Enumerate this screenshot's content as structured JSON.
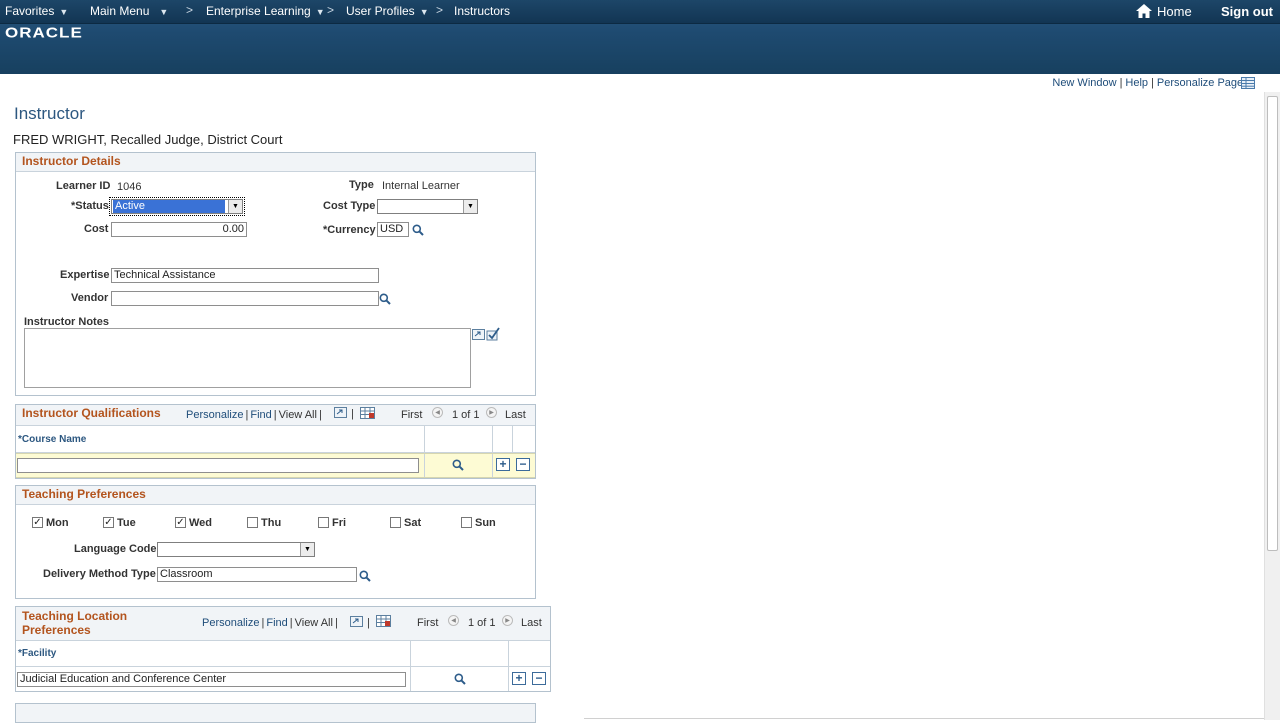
{
  "nav": {
    "favorites": "Favorites",
    "main_menu": "Main Menu",
    "breadcrumb": [
      "Enterprise Learning",
      "User Profiles",
      "Instructors"
    ],
    "separator": ">",
    "home": "Home",
    "sign_out": "Sign out"
  },
  "brand": {
    "logo": "ORACLE"
  },
  "page_links": {
    "new_window": "New Window",
    "help": "Help",
    "personalize_page": "Personalize Page"
  },
  "page": {
    "title": "Instructor",
    "subtitle": "FRED WRIGHT, Recalled Judge, District Court"
  },
  "details": {
    "title": "Instructor Details",
    "learner_id_label": "Learner ID",
    "learner_id": "1046",
    "type_label": "Type",
    "type": "Internal Learner",
    "status_label": "*Status",
    "status": "Active",
    "cost_type_label": "Cost Type",
    "cost_type": "",
    "cost_label": "Cost",
    "cost": "0.00",
    "currency_label": "*Currency",
    "currency": "USD",
    "expertise_label": "Expertise",
    "expertise": "Technical Assistance",
    "vendor_label": "Vendor",
    "vendor": "",
    "notes_label": "Instructor Notes"
  },
  "qualifications": {
    "title": "Instructor Qualifications",
    "personalize": "Personalize",
    "find": "Find",
    "view_all": "View All",
    "first": "First",
    "range": "1 of 1",
    "last": "Last",
    "col_course": "*Course Name",
    "course": ""
  },
  "teaching": {
    "title": "Teaching Preferences",
    "days": [
      {
        "label": "Mon",
        "checked": true
      },
      {
        "label": "Tue",
        "checked": true
      },
      {
        "label": "Wed",
        "checked": true
      },
      {
        "label": "Thu",
        "checked": false
      },
      {
        "label": "Fri",
        "checked": false
      },
      {
        "label": "Sat",
        "checked": false
      },
      {
        "label": "Sun",
        "checked": false
      }
    ],
    "language_label": "Language Code",
    "language": "",
    "delivery_label": "Delivery Method Type",
    "delivery": "Classroom"
  },
  "location": {
    "title_line1": "Teaching Location",
    "title_line2": "Preferences",
    "personalize": "Personalize",
    "find": "Find",
    "view_all": "View All",
    "first": "First",
    "range": "1 of 1",
    "last": "Last",
    "col_facility": "*Facility",
    "facility": "Judicial Education and Conference Center"
  },
  "symbols": {
    "plus": "+",
    "minus": "−",
    "check": "✓",
    "caret": "▼",
    "prev": "◀",
    "next": "▶"
  },
  "colors": {
    "header": "#1e4a70",
    "section_title": "#b3541e",
    "link": "#1f4d7a",
    "row_highlight": "#fdfbd4",
    "selection": "#3a72d6"
  }
}
